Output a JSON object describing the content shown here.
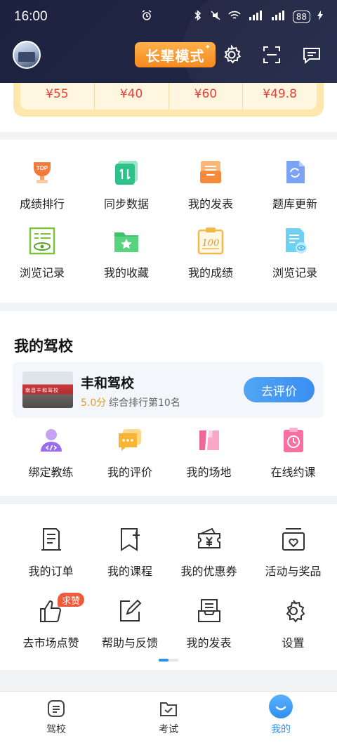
{
  "status_bar": {
    "time": "16:00",
    "battery": "88"
  },
  "header": {
    "elder_mode_label": "长辈模式"
  },
  "prices": [
    "¥55",
    "¥40",
    "¥60",
    "¥49.8"
  ],
  "tools": [
    {
      "label": "成绩排行",
      "icon": "trophy-top-icon"
    },
    {
      "label": "同步数据",
      "icon": "sync-data-icon"
    },
    {
      "label": "我的发表",
      "icon": "inbox-tray-icon"
    },
    {
      "label": "题库更新",
      "icon": "refresh-doc-icon"
    },
    {
      "label": "浏览记录",
      "icon": "eye-document-icon"
    },
    {
      "label": "我的收藏",
      "icon": "star-folder-icon"
    },
    {
      "label": "我的成绩",
      "icon": "score-100-icon"
    },
    {
      "label": "浏览记录",
      "icon": "eye-file-icon"
    }
  ],
  "school": {
    "section_title": "我的驾校",
    "name": "丰和驾校",
    "score": "5.0分",
    "rank": "综合排行第10名",
    "rate_button": "去评价",
    "sign_text": "南昌丰和驾校"
  },
  "school_actions": [
    {
      "label": "绑定教练",
      "icon": "coach-icon"
    },
    {
      "label": "我的评价",
      "icon": "comment-bubble-icon"
    },
    {
      "label": "我的场地",
      "icon": "field-icon"
    },
    {
      "label": "在线约课",
      "icon": "clock-clipboard-icon"
    }
  ],
  "services": [
    {
      "label": "我的订单",
      "icon": "order-list-icon"
    },
    {
      "label": "我的课程",
      "icon": "bookmark-plus-icon"
    },
    {
      "label": "我的优惠券",
      "icon": "coupon-yen-icon"
    },
    {
      "label": "活动与奖品",
      "icon": "gift-box-icon"
    },
    {
      "label": "去市场点赞",
      "icon": "thumbs-up-icon"
    },
    {
      "label": "帮助与反馈",
      "icon": "edit-feedback-icon"
    },
    {
      "label": "我的发表",
      "icon": "tray-icon"
    },
    {
      "label": "设置",
      "icon": "gear-icon"
    }
  ],
  "like_badge": "求赞",
  "tabs": [
    {
      "label": "驾校",
      "icon": "school-tab-icon"
    },
    {
      "label": "考试",
      "icon": "exam-tab-icon"
    },
    {
      "label": "我的",
      "icon": "profile-tab-icon",
      "active": true
    }
  ],
  "colors": {
    "accent": "#2f8ff0",
    "header": "#1f2542",
    "orange": "#f58a1f",
    "price": "#e8403a"
  }
}
